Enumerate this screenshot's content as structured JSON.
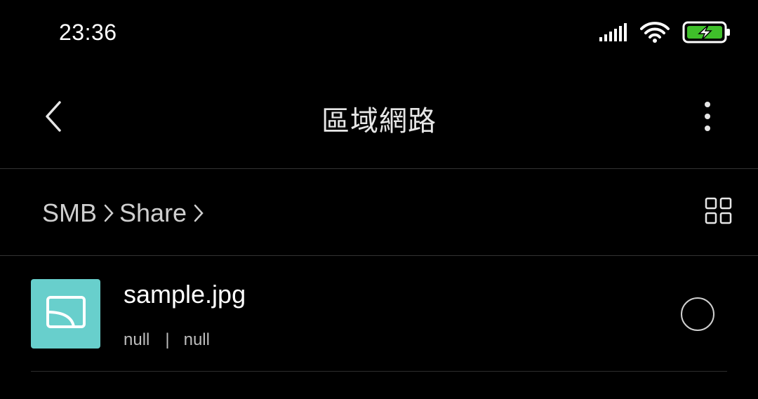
{
  "status_bar": {
    "time": "23:36",
    "icons": [
      "signal-icon",
      "wifi-icon",
      "battery-charging-icon"
    ],
    "battery_color": "#3fbf2a"
  },
  "header": {
    "title": "區域網路",
    "back_icon": "chevron-left-icon",
    "more_icon": "more-vertical-icon"
  },
  "breadcrumb": {
    "items": [
      "SMB",
      "Share"
    ],
    "view_toggle_icon": "grid-view-icon"
  },
  "files": [
    {
      "name": "sample.jpg",
      "meta_left": "null",
      "meta_sep": "|",
      "meta_right": "null",
      "icon": "image-file-icon",
      "thumb_color": "#68cfcc"
    }
  ],
  "colors": {
    "background": "#000000",
    "text": "#ffffff",
    "divider": "#333333"
  }
}
